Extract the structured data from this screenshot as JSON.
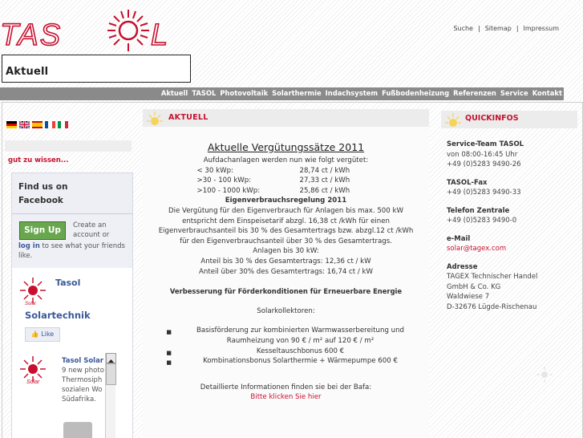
{
  "header": {
    "logo_text": "TASOL",
    "top_links": [
      "Suche",
      "Sitemap",
      "Impressum"
    ],
    "section_title": "Aktuell"
  },
  "nav": [
    "Aktuell",
    "TASOL",
    "Photovoltaik",
    "Solarthermie",
    "Indachsystem",
    "Fußbodenheizung",
    "Referenzen",
    "Service",
    "Kontakt"
  ],
  "sidebar": {
    "flags": [
      "german-flag",
      "british-flag",
      "spanish-flag",
      "french-flag",
      "italian-flag"
    ],
    "gut_zu_wissen": "gut zu wissen...",
    "facebook": {
      "header": "Find us on Facebook",
      "signup_label": "Sign Up",
      "create_text": "Create an account or",
      "login_link": "log in",
      "login_rest": "to see what your friends like.",
      "page_name": "Tasol",
      "page_name2": "Solartechnik",
      "like_label": "Like",
      "post_author": "Tasol Solar",
      "post_text": "9 new photo Thermosiph sozialen Wo Südafrika."
    }
  },
  "main": {
    "heading": "AKTUELL",
    "title": "Aktuelle Vergütungssätze 2011",
    "intro": "Aufdachanlagen werden nun wie folgt vergütet:",
    "tarifs": [
      {
        "range": "< 30 kWp:",
        "rate": "28,74 ct / kWh"
      },
      {
        "range": ">30 - 100 kWp:",
        "rate": "27,33 ct / kWh"
      },
      {
        "range": ">100 - 1000 kWp:",
        "rate": "25,86 ct / kWh"
      }
    ],
    "eigen_title": "Eigenverbrauchsregelung 2011",
    "eigen_lines": [
      "Die Vergütung für den Eigenverbrauch für Anlagen bis max. 500 kW",
      "entspricht dem Einspeisetarif abzgl. 16,38 ct /kWh für einen",
      "Eigenverbrauchsanteil bis 30 % des Gesamtertrags bzw. abzgl.12 ct /kWh",
      "für den Eigenverbrauchsanteil über 30 % des Gesamtertrags.",
      "Anlagen bis 30 kW:",
      "Anteil bis 30 % des Gesamtertrags: 12,36 ct / kW",
      "Anteil über 30% des Gesamtertrags: 16,74 ct / kW"
    ],
    "foerder_title": "Verbesserung für Förderkonditionen für Erneuerbare Energie",
    "kollektoren": "Solarkollektoren:",
    "bullets": [
      "Basisförderung zur kombinierten Warmwasserbereitung und Raumheizung von 90 € / m² auf 120 € / m²",
      "Kesseltauschbonus 600 €",
      "Kombinationsbonus Solarthermie + Wärmepumpe 600 €"
    ],
    "detail_text": "Detaillierte Informationen finden sie bei der Bafa:",
    "detail_link": "Bitte klicken Sie hier"
  },
  "quickinfos": {
    "heading": "QUICKINFOS",
    "service_label": "Service-Team TASOL",
    "service_hours": "von 08:00-16:45 Uhr",
    "service_phone": "+49 (0)5283 9490-26",
    "fax_label": "TASOL-Fax",
    "fax_value": "+49 (0)5283 9490-33",
    "tel_label": "Telefon Zentrale",
    "tel_value": "+49 (0)5283 9490-0",
    "email_label": "e-Mail",
    "email_value": "solar@tagex.com",
    "address_label": "Adresse",
    "address_lines": [
      "TAGEX Technischer Handel",
      "GmbH & Co. KG",
      "Waldwiese 7",
      "D-32676 Lügde-Rischenau"
    ]
  },
  "colors": {
    "accent": "#c8102e",
    "nav_bg": "#8a8a8a",
    "facebook_blue": "#3b5998",
    "signup_green": "#69a74e"
  }
}
